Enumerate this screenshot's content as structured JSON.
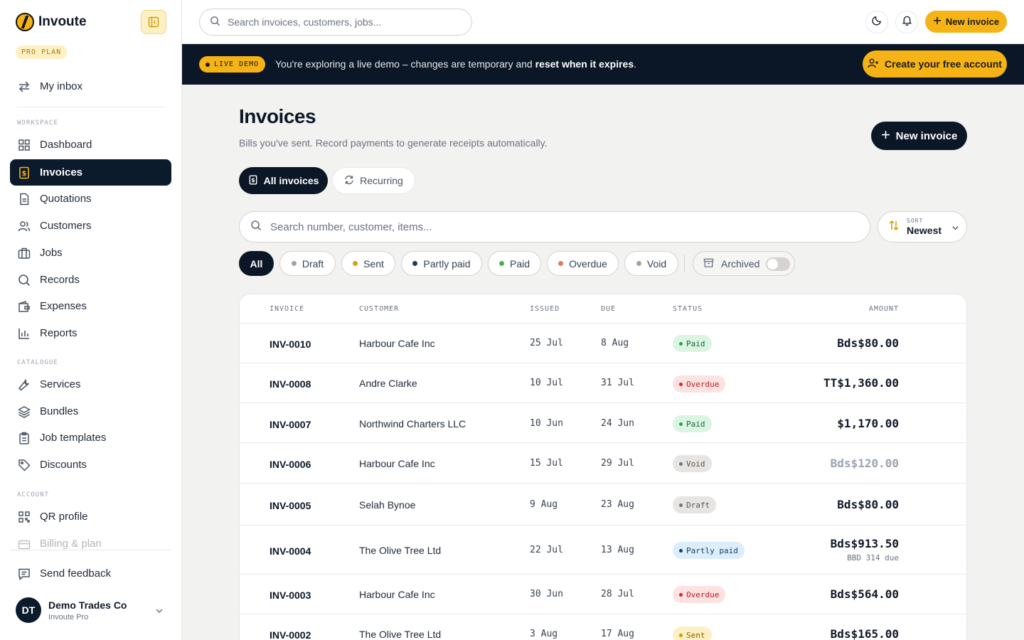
{
  "brand": {
    "name": "Invoute",
    "plan": "PRO PLAN"
  },
  "sidebar": {
    "inbox": "My inbox",
    "sections": {
      "workspace": "WORKSPACE",
      "catalogue": "CATALOGUE",
      "account": "ACCOUNT"
    },
    "workspace": [
      {
        "label": "Dashboard",
        "icon": "grid-icon"
      },
      {
        "label": "Invoices",
        "icon": "dollar-receipt-icon",
        "active": true
      },
      {
        "label": "Quotations",
        "icon": "document-icon"
      },
      {
        "label": "Customers",
        "icon": "users-icon"
      },
      {
        "label": "Jobs",
        "icon": "briefcase-icon"
      },
      {
        "label": "Records",
        "icon": "search-icon"
      },
      {
        "label": "Expenses",
        "icon": "wallet-icon"
      },
      {
        "label": "Reports",
        "icon": "bar-chart-icon"
      }
    ],
    "catalogue": [
      {
        "label": "Services",
        "icon": "wrench-icon"
      },
      {
        "label": "Bundles",
        "icon": "layers-icon"
      },
      {
        "label": "Job templates",
        "icon": "clipboard-icon"
      },
      {
        "label": "Discounts",
        "icon": "tag-icon"
      }
    ],
    "account": [
      {
        "label": "QR profile",
        "icon": "qr-icon"
      },
      {
        "label": "Billing & plan",
        "icon": "card-icon"
      }
    ],
    "feedback": "Send feedback",
    "user": {
      "initials": "DT",
      "name": "Demo Trades Co",
      "plan": "Invoute Pro"
    }
  },
  "topbar": {
    "search_placeholder": "Search invoices, customers, jobs...",
    "new_invoice": "New invoice"
  },
  "banner": {
    "pill": "LIVE DEMO",
    "text": "You're exploring a live demo – changes are temporary and ",
    "text_bold": "reset when it expires",
    "text_end": ".",
    "cta": "Create your free account"
  },
  "main": {
    "title": "Invoices",
    "subtitle": "Bills you've sent. Record payments to generate receipts automatically.",
    "new_invoice": "New invoice",
    "tabs": {
      "all": "All invoices",
      "recurring": "Recurring"
    },
    "search_placeholder": "Search number, customer, items...",
    "sort": {
      "label": "SORT",
      "value": "Newest"
    },
    "filters": [
      {
        "label": "All",
        "active": true
      },
      {
        "label": "Draft",
        "color": "#a8a29e"
      },
      {
        "label": "Sent",
        "color": "#d4a017"
      },
      {
        "label": "Partly paid",
        "color": "#1e3a5f"
      },
      {
        "label": "Paid",
        "color": "#4caf50"
      },
      {
        "label": "Overdue",
        "color": "#e07a5f"
      },
      {
        "label": "Void",
        "color": "#a8a29e"
      }
    ],
    "archived": "Archived"
  },
  "table": {
    "headers": {
      "invoice": "INVOICE",
      "customer": "CUSTOMER",
      "issued": "ISSUED",
      "due": "DUE",
      "status": "STATUS",
      "amount": "AMOUNT"
    },
    "rows": [
      {
        "invoice": "INV-0010",
        "customer": "Harbour Cafe Inc",
        "issued": "25 Jul",
        "due": "8 Aug",
        "status": "Paid",
        "amount": "Bds$80.00"
      },
      {
        "invoice": "INV-0008",
        "customer": "Andre Clarke",
        "issued": "10 Jul",
        "due": "31 Jul",
        "status": "Overdue",
        "amount": "TT$1,360.00"
      },
      {
        "invoice": "INV-0007",
        "customer": "Northwind Charters LLC",
        "issued": "10 Jun",
        "due": "24 Jun",
        "status": "Paid",
        "amount": "$1,170.00"
      },
      {
        "invoice": "INV-0006",
        "customer": "Harbour Cafe Inc",
        "issued": "15 Jul",
        "due": "29 Jul",
        "status": "Void",
        "amount": "Bds$120.00"
      },
      {
        "invoice": "INV-0005",
        "customer": "Selah Bynoe",
        "issued": "9 Aug",
        "due": "23 Aug",
        "status": "Draft",
        "amount": "Bds$80.00"
      },
      {
        "invoice": "INV-0004",
        "customer": "The Olive Tree Ltd",
        "issued": "22 Jul",
        "due": "13 Aug",
        "status": "Partly paid",
        "amount": "Bds$913.50",
        "due_note": "BBD 314 due"
      },
      {
        "invoice": "INV-0003",
        "customer": "Harbour Cafe Inc",
        "issued": "30 Jun",
        "due": "28 Jul",
        "status": "Overdue",
        "amount": "Bds$564.00"
      },
      {
        "invoice": "INV-0002",
        "customer": "The Olive Tree Ltd",
        "issued": "3 Aug",
        "due": "17 Aug",
        "status": "Sent",
        "amount": "Bds$165.00"
      }
    ]
  },
  "colors": {
    "accent": "#f5b316",
    "navy": "#0b1726"
  }
}
